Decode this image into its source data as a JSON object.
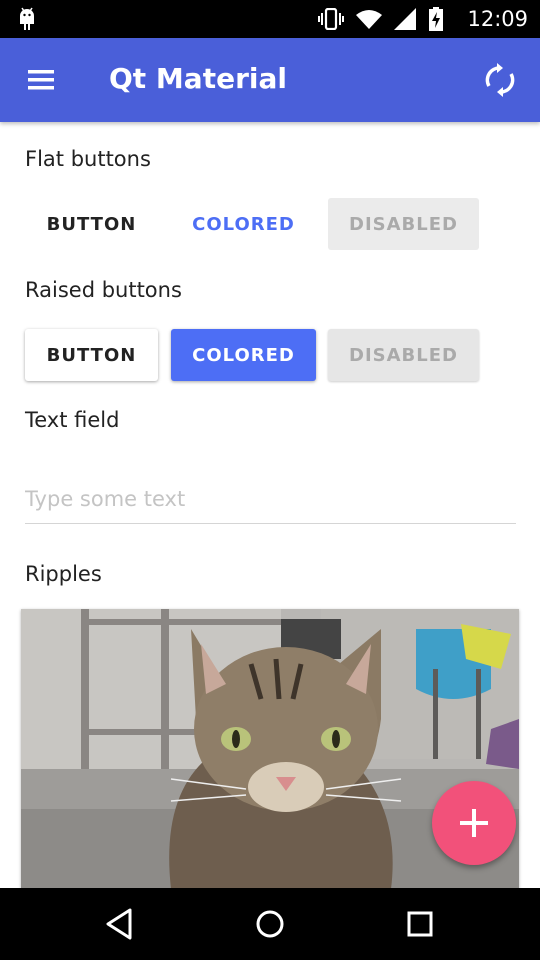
{
  "status_bar": {
    "time": "12:09",
    "icons": [
      "android-debug-icon",
      "vibrate-icon",
      "wifi-icon",
      "signal-icon",
      "battery-charging-icon"
    ]
  },
  "app_bar": {
    "title": "Qt Material",
    "color": "#4a5fd9",
    "icons": [
      "menu-icon",
      "refresh-icon"
    ]
  },
  "sections": {
    "flat_title": "Flat buttons",
    "raised_title": "Raised buttons",
    "text_field_title": "Text field",
    "ripples_title": "Ripples"
  },
  "flat_buttons": {
    "button": "BUTTON",
    "colored": "COLORED",
    "disabled": "DISABLED"
  },
  "raised_buttons": {
    "button": "BUTTON",
    "colored": "COLORED",
    "disabled": "DISABLED"
  },
  "text_field": {
    "placeholder": "Type some text",
    "value": ""
  },
  "ripples": {
    "image": "cat-photo",
    "fab_icon": "plus-icon",
    "fab_color": "#f2517a"
  },
  "accent_color": "#4d6ef5",
  "nav_bar": {
    "icons": [
      "back-icon",
      "home-icon",
      "recents-icon"
    ]
  }
}
